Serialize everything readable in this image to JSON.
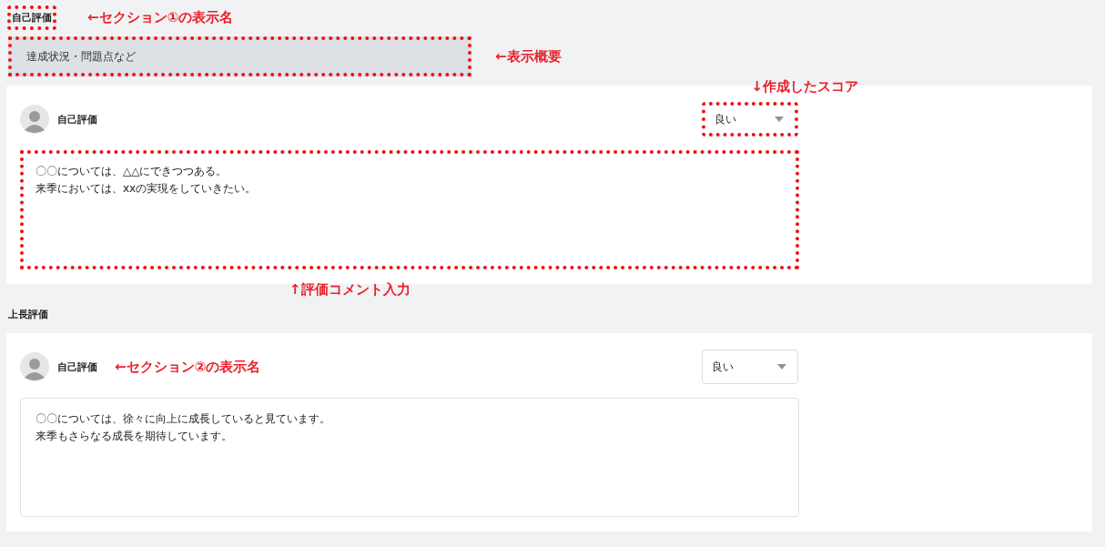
{
  "sections": [
    {
      "title": "自己評価",
      "title_highlighted": true,
      "title_note": "←セクション①の表示名",
      "description": "達成状況・問題点など",
      "description_highlighted": true,
      "description_note": "←表示概要",
      "entry": {
        "name": "自己評価",
        "score": "良い",
        "score_highlighted": true,
        "score_note": "↓作成したスコア",
        "comment_lines": [
          "〇〇については、△△にできつつある。",
          "来季においては、xxの実現をしていきたい。"
        ],
        "comment_highlighted": true,
        "comment_note": "↑評価コメント入力"
      }
    },
    {
      "title": "上長評価",
      "title_highlighted": false,
      "entry": {
        "name": "自己評価",
        "name_note": "←セクション②の表示名",
        "score": "良い",
        "score_highlighted": false,
        "comment_lines": [
          "〇〇については、徐々に向上に成長していると見ています。",
          "来季もさらなる成長を期待しています。"
        ],
        "comment_highlighted": false
      }
    }
  ]
}
